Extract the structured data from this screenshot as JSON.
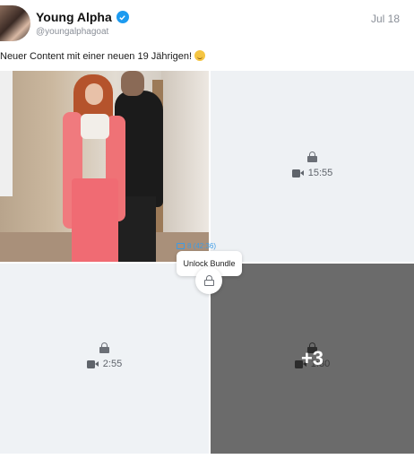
{
  "post": {
    "author": {
      "display_name": "Young Alpha",
      "handle": "@youngalphagoat",
      "verified": true
    },
    "date": "Jul 18",
    "caption": "Neuer Content mit einer neuen 19 Jährigen!",
    "caption_emoji": "smirking-face"
  },
  "media": {
    "tiles": [
      {
        "type": "photo",
        "locked": false
      },
      {
        "type": "video",
        "locked": true,
        "duration": "15:55"
      },
      {
        "type": "video",
        "locked": true,
        "duration": "2:55"
      },
      {
        "type": "video",
        "locked": true,
        "duration": "1:30",
        "overlay": "+3"
      }
    ]
  },
  "unlock": {
    "bundle_text": "8 (42:36)",
    "button_label": "Unlock Bundle"
  },
  "colors": {
    "accent": "#1d9bf0",
    "link": "#3b9be6",
    "locked_tile": "#eef1f4",
    "dark_tile": "#6b6b6b"
  }
}
